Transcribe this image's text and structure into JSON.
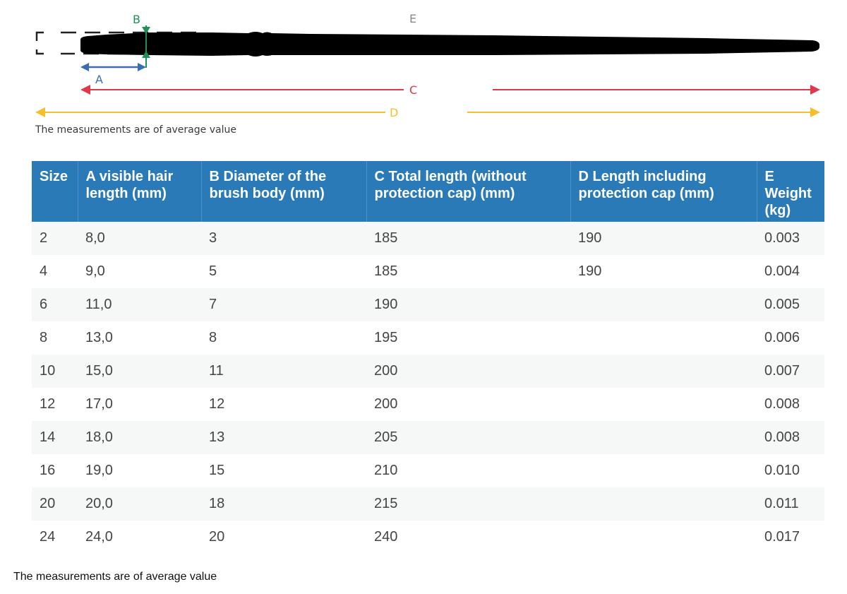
{
  "diagram": {
    "label_a": "A",
    "label_b": "B",
    "label_c": "C",
    "label_d": "D",
    "label_e": "E",
    "note": "The measurements are of average value",
    "colors": {
      "a": "#3b6db5",
      "b": "#1f9158",
      "c": "#e0374a",
      "d": "#f4be2c",
      "e": "#8a8a8a"
    }
  },
  "table": {
    "headers": [
      "Size",
      "A visible hair length (mm)",
      "B Diameter of the brush body (mm)",
      "C Total length (without protection cap) (mm)",
      "D Length including protection cap (mm)",
      "E Weight (kg)"
    ],
    "rows": [
      [
        "2",
        "8,0",
        "3",
        "185",
        "190",
        "0.003"
      ],
      [
        "4",
        "9,0",
        "5",
        "185",
        "190",
        "0.004"
      ],
      [
        "6",
        "11,0",
        "7",
        "190",
        "",
        "0.005"
      ],
      [
        "8",
        "13,0",
        "8",
        "195",
        "",
        "0.006"
      ],
      [
        "10",
        "15,0",
        "11",
        "200",
        "",
        "0.007"
      ],
      [
        "12",
        "17,0",
        "12",
        "200",
        "",
        "0.008"
      ],
      [
        "14",
        "18,0",
        "13",
        "205",
        "",
        "0.008"
      ],
      [
        "16",
        "19,0",
        "15",
        "210",
        "",
        "0.010"
      ],
      [
        "20",
        "20,0",
        "18",
        "215",
        "",
        "0.011"
      ],
      [
        "24",
        "24,0",
        "20",
        "240",
        "",
        "0.017"
      ]
    ]
  },
  "footer_note": "The measurements are of average value"
}
